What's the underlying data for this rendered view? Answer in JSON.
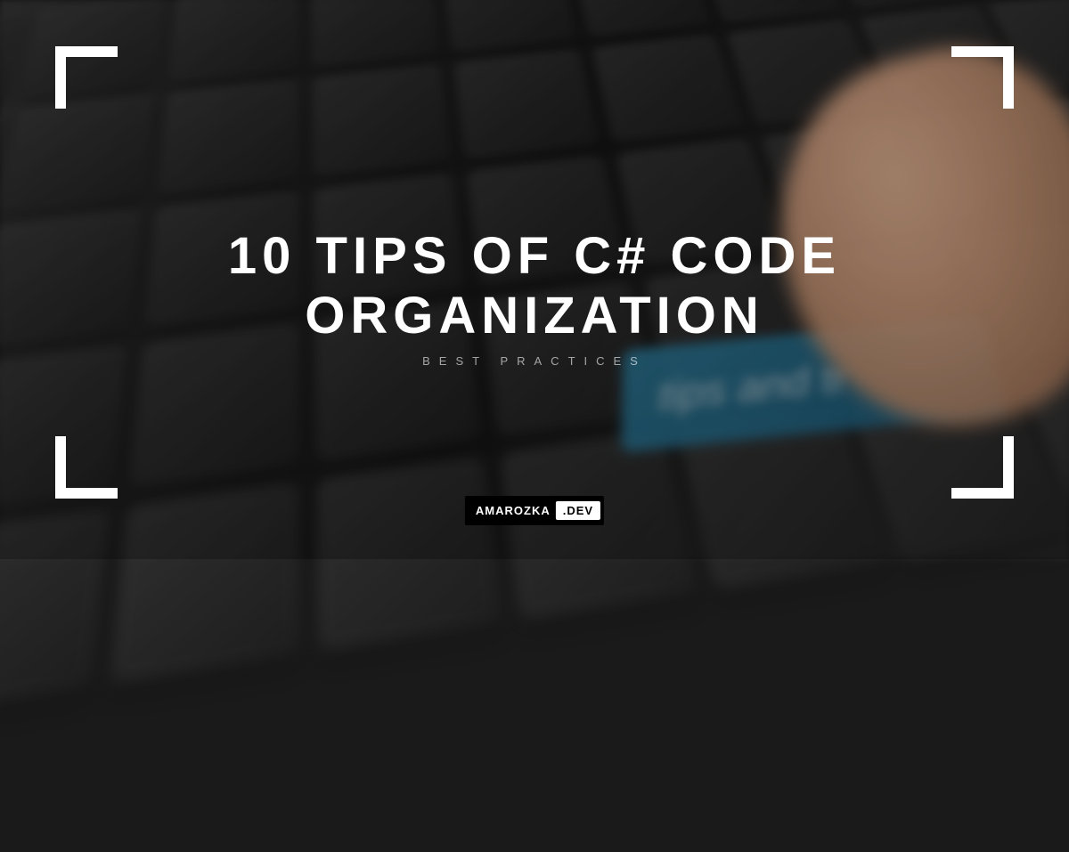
{
  "title": "10 TIPS OF C# CODE ORGANIZATION",
  "subtitle": "BEST PRACTICES",
  "brand": {
    "name": "AMAROZKA",
    "ext": ".DEV"
  },
  "background": {
    "accent_key_text": "tips and tr",
    "accent_color": "#2a7a9a"
  }
}
